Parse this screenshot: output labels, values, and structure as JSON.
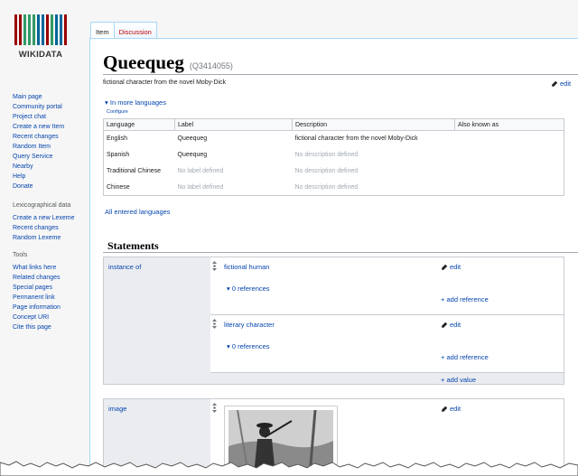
{
  "logo": {
    "wordmark": "WIKIDATA",
    "bar_colors": [
      "#990000",
      "#990000",
      "#339966",
      "#339966",
      "#339966",
      "#006699",
      "#006699",
      "#990000",
      "#339966",
      "#006699",
      "#006699",
      "#990000"
    ]
  },
  "sidebar": {
    "main_links": [
      "Main page",
      "Community portal",
      "Project chat",
      "Create a new Item",
      "Recent changes",
      "Random Item",
      "Query Service",
      "Nearby",
      "Help",
      "Donate"
    ],
    "lexicographical_heading": "Lexicographical data",
    "lexicographical_links": [
      "Create a new Lexeme",
      "Recent changes",
      "Random Lexeme"
    ],
    "tools_heading": "Tools",
    "tools_links": [
      "What links here",
      "Related changes",
      "Special pages",
      "Permanent link",
      "Page information",
      "Concept URI",
      "Cite this page"
    ]
  },
  "tabs": {
    "item": "Item",
    "discussion": "Discussion"
  },
  "page": {
    "title": "Queequeg",
    "qid": "(Q3414055)",
    "description": "fictional character from the novel Moby-Dick",
    "edit": "edit",
    "in_more_languages": "In more languages",
    "configure": "Configure",
    "all_entered_languages": "All entered languages"
  },
  "lang_table": {
    "headers": [
      "Language",
      "Label",
      "Description",
      "Also known as"
    ],
    "rows": [
      {
        "language": "English",
        "label": "Queequeg",
        "description": "fictional character from the novel Moby-Dick",
        "aliases": ""
      },
      {
        "language": "Spanish",
        "label": "Queequeg",
        "description": "No description defined",
        "aliases": ""
      },
      {
        "language": "Traditional Chinese",
        "label": "No label defined",
        "description": "No description defined",
        "aliases": ""
      },
      {
        "language": "Chinese",
        "label": "No label defined",
        "description": "No description defined",
        "aliases": ""
      }
    ]
  },
  "statements": {
    "heading": "Statements",
    "groups": [
      {
        "property": "instance of",
        "values": [
          {
            "value": "fictional human",
            "references": "0 references"
          },
          {
            "value": "literary character",
            "references": "0 references"
          }
        ]
      },
      {
        "property": "image"
      }
    ],
    "edit": "edit",
    "add_reference": "add reference",
    "add_value": "add value"
  }
}
